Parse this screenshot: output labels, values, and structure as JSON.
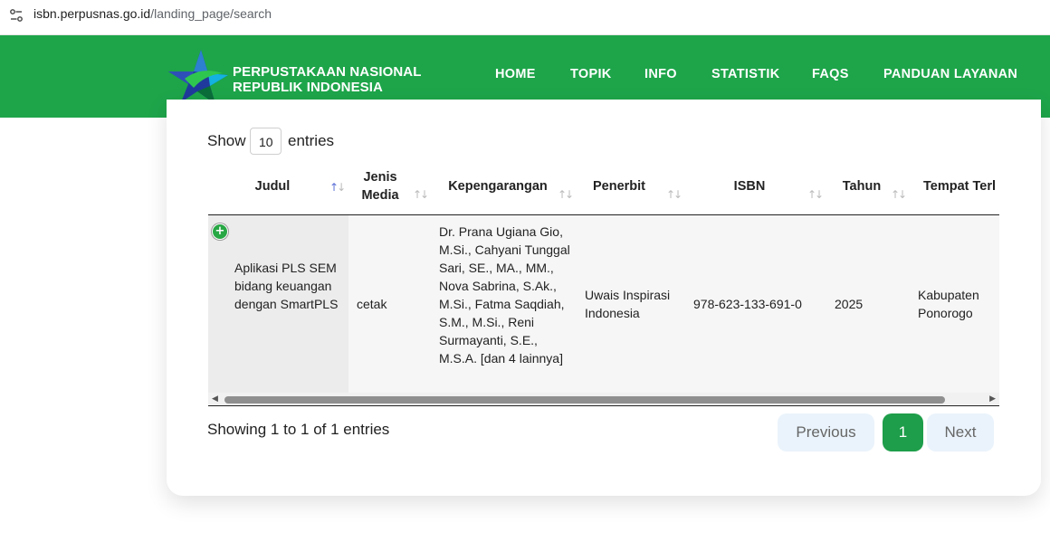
{
  "browser": {
    "url_host": "isbn.perpusnas.go.id",
    "url_path": "/landing_page/search"
  },
  "header": {
    "brand_line1": "PERPUSTAKAAN NASIONAL",
    "brand_line2": "REPUBLIK INDONESIA",
    "nav": [
      "HOME",
      "TOPIK",
      "INFO",
      "STATISTIK",
      "FAQS",
      "PANDUAN LAYANAN"
    ],
    "color": "#1ea54a"
  },
  "table_controls": {
    "show_label": "Show",
    "page_length": "10",
    "entries_label": "entries"
  },
  "table": {
    "columns": [
      "Judul",
      "Jenis Media",
      "Kepengarangan",
      "Penerbit",
      "ISBN",
      "Tahun",
      "Tempat Terl"
    ],
    "rows": [
      {
        "judul": "Aplikasi PLS SEM bidang keuangan dengan SmartPLS",
        "jenis_media": "cetak",
        "kepengarangan": "Dr. Prana Ugiana Gio, M.Si., Cahyani Tunggal Sari, SE., MA., MM., Nova Sabrina, S.Ak., M.Si., Fatma Saqdiah, S.M., M.Si., Reni Surmayanti, S.E., M.S.A. [dan 4 lainnya]",
        "penerbit": "Uwais Inspirasi Indonesia",
        "isbn": "978-623-133-691-0",
        "tahun": "2025",
        "tempat": "Kabupaten Ponorogo"
      }
    ]
  },
  "footer": {
    "info": "Showing 1 to 1 of 1 entries",
    "prev": "Previous",
    "page": "1",
    "next": "Next"
  }
}
